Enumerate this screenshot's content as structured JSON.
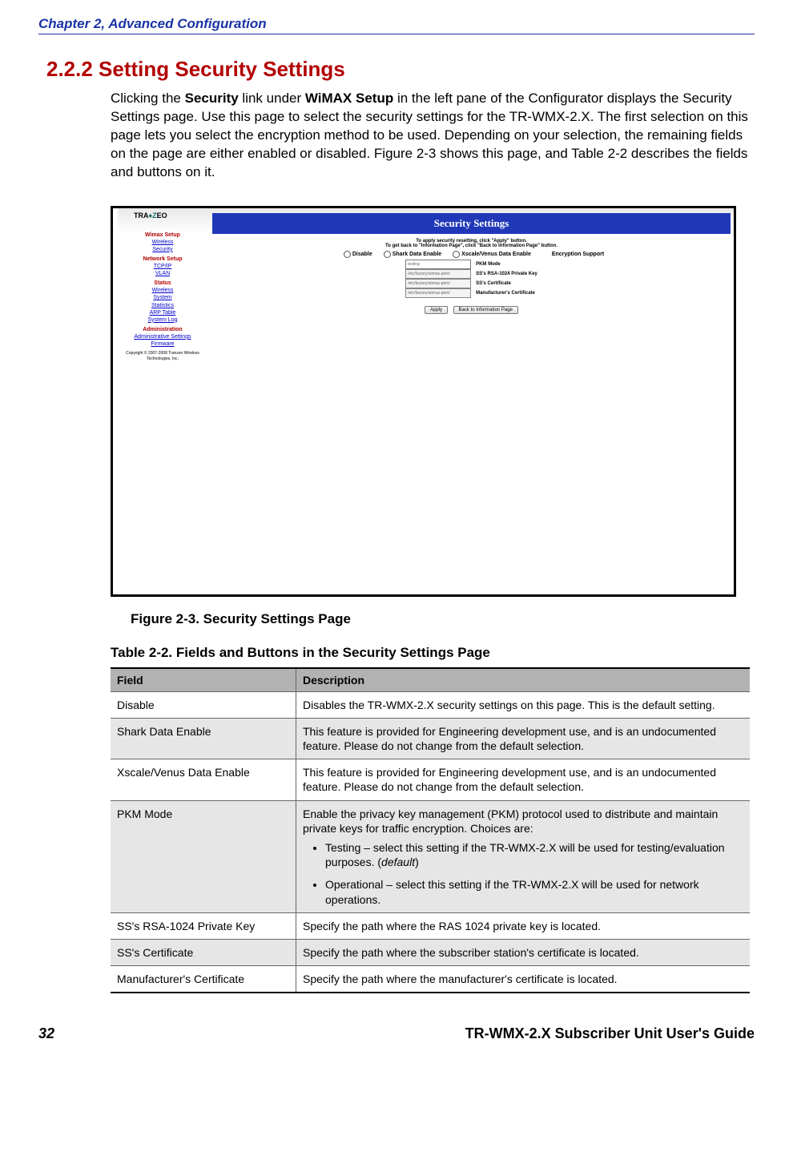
{
  "chapter_header": "Chapter 2, Advanced Configuration",
  "section_heading": "2.2.2 Setting Security Settings",
  "body_text_pre": "Clicking the ",
  "body_bold1": "Security",
  "body_text_mid1": " link under ",
  "body_bold2": "WiMAX Setup",
  "body_text_post": " in the left pane of the Configurator displays the Security Settings page. Use this page to select the security settings for the TR-WMX-2.X. The first selection on this page lets you select the encryption method to be used. Depending on your selection, the remaining fields on the page are either enabled or disabled. Figure 2-3 shows this page, and Table 2-2 describes the fields and buttons on it.",
  "figure_caption": "Figure 2-3. Security Settings Page",
  "table_caption": "Table 2-2. Fields and Buttons in the Security Settings Page",
  "columns": {
    "field": "Field",
    "desc": "Description"
  },
  "rows": [
    {
      "field": "Disable",
      "desc": "Disables the TR-WMX-2.X security settings on this page. This is the default setting."
    },
    {
      "field": "Shark Data Enable",
      "desc": "This feature is provided for Engineering development use, and is an undocumented feature. Please do not change from the default selection."
    },
    {
      "field": "Xscale/Venus Data Enable",
      "desc": "This feature is provided for Engineering development use, and is an undocumented feature. Please do not change from the default selection."
    },
    {
      "field": "PKM Mode",
      "desc_pre": "Enable the privacy key management (PKM) protocol used to distribute and maintain private keys for traffic encryption. Choices are:",
      "bullets": [
        {
          "pre": "Testing – select this setting if the TR-WMX-2.X will be used for testing/evaluation purposes. (",
          "ital": "default",
          "post": ")"
        },
        {
          "text": "Operational – select this setting if the TR-WMX-2.X will be used for network operations."
        }
      ]
    },
    {
      "field": "SS's RSA-1024 Private Key",
      "desc": "Specify the path where the RAS 1024 private key is located."
    },
    {
      "field": "SS's Certificate",
      "desc": "Specify the path where the subscriber station's certificate is located."
    },
    {
      "field": "Manufacturer's Certificate",
      "desc": "Specify the path where the manufacturer's certificate is located."
    }
  ],
  "shot": {
    "logo_parts": {
      "tra": "TRA",
      "z": "♦Z",
      "eo": "EO"
    },
    "title": "Security Settings",
    "hint1": "To apply security resetting, click \"Apply\" button.",
    "hint2": "To get back to \"Information Page\", click \"Back to Information Page\" button.",
    "radios": {
      "r1": "Disable",
      "r2": "Shark Data Enable",
      "r3": "Xscale/Venus Data Enable"
    },
    "enc_label": "Encryption Support",
    "fields_inputs": [
      "testing",
      "/etc/factory/wimax-pkm/",
      "/etc/factory/wimax-pkm/",
      "/etc/factory/wimax-pkm/"
    ],
    "fields_labels": [
      "PKM Mode",
      "SS's RSA-1024 Private Key",
      "SS's Certificate",
      "Manufacturer's Certificate"
    ],
    "btn_apply": "Apply",
    "btn_back": "Back to Information Page",
    "nav": {
      "cat1": "Wimax Setup",
      "l1": "Wireless",
      "l2": "Security",
      "cat2": "Network Setup",
      "l3": "TCP/IP",
      "l4": "VLAN",
      "cat3": "Status",
      "l5": "Wireless",
      "l6": "System",
      "l7": "Statistics",
      "l8": "ARP Table",
      "l9": "System Log",
      "cat4": "Administration",
      "l10": "Administrative Settings",
      "l11": "Firmware",
      "copy": "Copyright © 2007-2008 Tranzeo Wireless Technologies, Inc."
    }
  },
  "footer": {
    "page": "32",
    "guide": "TR-WMX-2.X Subscriber Unit User's Guide"
  }
}
